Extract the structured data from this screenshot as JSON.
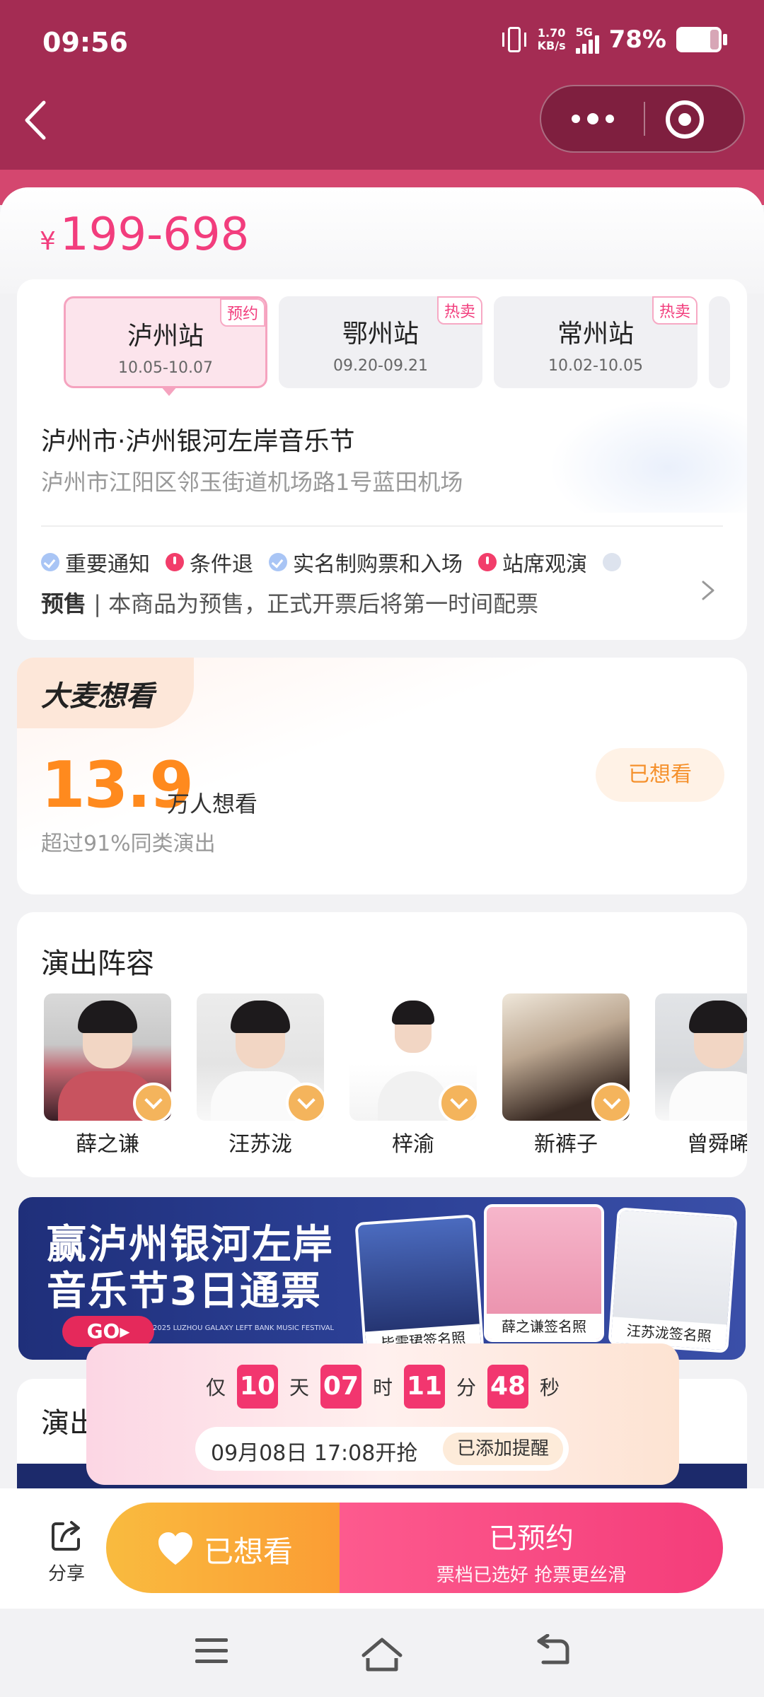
{
  "status_bar": {
    "time": "09:56",
    "net_speed_value": "1.70",
    "net_speed_unit": "KB/s",
    "network": "5G",
    "battery": "78%"
  },
  "header": {
    "back_icon": "chevron-left-icon",
    "more_icon": "more-dots-icon",
    "close_icon": "target-close-icon"
  },
  "price": {
    "currency": "¥",
    "range": "199-698"
  },
  "stations": [
    {
      "name": "泸州站",
      "dates": "10.05-10.07",
      "tag": "预约",
      "active": true
    },
    {
      "name": "鄂州站",
      "dates": "09.20-09.21",
      "tag": "热卖",
      "active": false
    },
    {
      "name": "常州站",
      "dates": "10.02-10.05",
      "tag": "热卖",
      "active": false
    }
  ],
  "venue": {
    "title": "泸州市·泸州银河左岸音乐节",
    "address": "泸州市江阳区邻玉街道机场路1号蓝田机场"
  },
  "notices": [
    {
      "label": "重要通知",
      "icon": "check-circle-icon"
    },
    {
      "label": "条件退",
      "icon": "alert-circle-icon"
    },
    {
      "label": "实名制购票和入场",
      "icon": "check-circle-icon"
    },
    {
      "label": "站席观演",
      "icon": "alert-circle-icon"
    }
  ],
  "presale": {
    "tag": "预售",
    "separator": " | ",
    "text": "本商品为预售，正式开票后将第一时间配票"
  },
  "want": {
    "logo": "大麦想看",
    "count": "13.9",
    "unit": "万人想看",
    "sub": "超过91%同类演出",
    "button": "已想看"
  },
  "lineup": {
    "title": "演出阵容",
    "artists": [
      {
        "name": "薛之谦"
      },
      {
        "name": "汪苏泷"
      },
      {
        "name": "梓渝"
      },
      {
        "name": "新裤子"
      },
      {
        "name": "曾舜晞"
      }
    ]
  },
  "banner": {
    "line1": "赢泸州银河左岸",
    "line2": "音乐节3日通票",
    "go": "GO▸",
    "english": "2025 LUZHOU GALAXY LEFT BANK MUSIC FESTIVAL",
    "cards": [
      "毕雯珺签名照",
      "薛之谦签名照",
      "汪苏泷签名照"
    ]
  },
  "show": {
    "title": "演出"
  },
  "countdown": {
    "prefix": "仅",
    "days": "10",
    "days_unit": "天",
    "hours": "07",
    "hours_unit": "时",
    "minutes": "11",
    "minutes_unit": "分",
    "seconds": "48",
    "seconds_unit": "秒",
    "time": "09月08日 17:08开抢",
    "reminder": "已添加提醒"
  },
  "bottom_bar": {
    "share": "分享",
    "want_button": "已想看",
    "reserve_button": "已预约",
    "reserve_sub": "票档已选好 抢票更丝滑"
  },
  "colors": {
    "header": "#a42c53",
    "accent": "#f23d7d",
    "want_orange": "#ff8a1e",
    "reserve_pink": "#f43d7a"
  }
}
